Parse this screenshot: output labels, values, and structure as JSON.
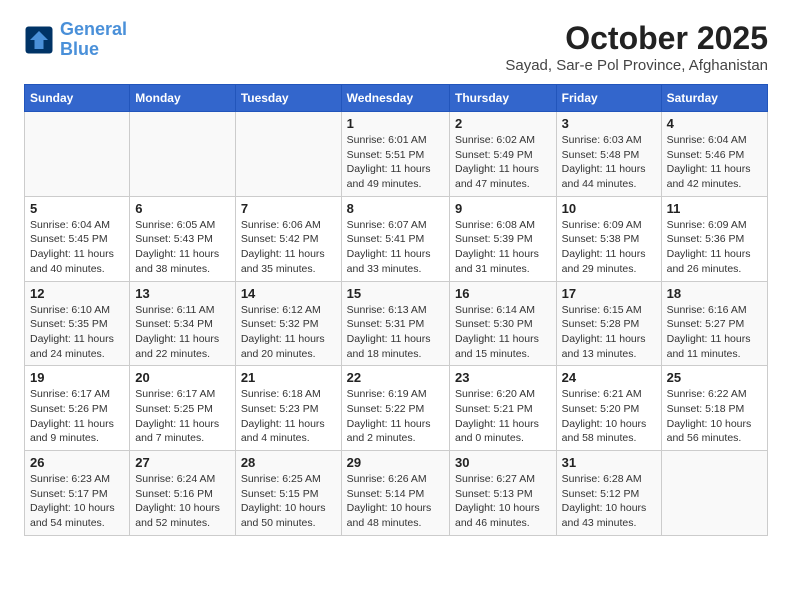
{
  "header": {
    "logo_line1": "General",
    "logo_line2": "Blue",
    "month": "October 2025",
    "location": "Sayad, Sar-e Pol Province, Afghanistan"
  },
  "days_of_week": [
    "Sunday",
    "Monday",
    "Tuesday",
    "Wednesday",
    "Thursday",
    "Friday",
    "Saturday"
  ],
  "weeks": [
    [
      {
        "day": "",
        "info": ""
      },
      {
        "day": "",
        "info": ""
      },
      {
        "day": "",
        "info": ""
      },
      {
        "day": "1",
        "info": "Sunrise: 6:01 AM\nSunset: 5:51 PM\nDaylight: 11 hours\nand 49 minutes."
      },
      {
        "day": "2",
        "info": "Sunrise: 6:02 AM\nSunset: 5:49 PM\nDaylight: 11 hours\nand 47 minutes."
      },
      {
        "day": "3",
        "info": "Sunrise: 6:03 AM\nSunset: 5:48 PM\nDaylight: 11 hours\nand 44 minutes."
      },
      {
        "day": "4",
        "info": "Sunrise: 6:04 AM\nSunset: 5:46 PM\nDaylight: 11 hours\nand 42 minutes."
      }
    ],
    [
      {
        "day": "5",
        "info": "Sunrise: 6:04 AM\nSunset: 5:45 PM\nDaylight: 11 hours\nand 40 minutes."
      },
      {
        "day": "6",
        "info": "Sunrise: 6:05 AM\nSunset: 5:43 PM\nDaylight: 11 hours\nand 38 minutes."
      },
      {
        "day": "7",
        "info": "Sunrise: 6:06 AM\nSunset: 5:42 PM\nDaylight: 11 hours\nand 35 minutes."
      },
      {
        "day": "8",
        "info": "Sunrise: 6:07 AM\nSunset: 5:41 PM\nDaylight: 11 hours\nand 33 minutes."
      },
      {
        "day": "9",
        "info": "Sunrise: 6:08 AM\nSunset: 5:39 PM\nDaylight: 11 hours\nand 31 minutes."
      },
      {
        "day": "10",
        "info": "Sunrise: 6:09 AM\nSunset: 5:38 PM\nDaylight: 11 hours\nand 29 minutes."
      },
      {
        "day": "11",
        "info": "Sunrise: 6:09 AM\nSunset: 5:36 PM\nDaylight: 11 hours\nand 26 minutes."
      }
    ],
    [
      {
        "day": "12",
        "info": "Sunrise: 6:10 AM\nSunset: 5:35 PM\nDaylight: 11 hours\nand 24 minutes."
      },
      {
        "day": "13",
        "info": "Sunrise: 6:11 AM\nSunset: 5:34 PM\nDaylight: 11 hours\nand 22 minutes."
      },
      {
        "day": "14",
        "info": "Sunrise: 6:12 AM\nSunset: 5:32 PM\nDaylight: 11 hours\nand 20 minutes."
      },
      {
        "day": "15",
        "info": "Sunrise: 6:13 AM\nSunset: 5:31 PM\nDaylight: 11 hours\nand 18 minutes."
      },
      {
        "day": "16",
        "info": "Sunrise: 6:14 AM\nSunset: 5:30 PM\nDaylight: 11 hours\nand 15 minutes."
      },
      {
        "day": "17",
        "info": "Sunrise: 6:15 AM\nSunset: 5:28 PM\nDaylight: 11 hours\nand 13 minutes."
      },
      {
        "day": "18",
        "info": "Sunrise: 6:16 AM\nSunset: 5:27 PM\nDaylight: 11 hours\nand 11 minutes."
      }
    ],
    [
      {
        "day": "19",
        "info": "Sunrise: 6:17 AM\nSunset: 5:26 PM\nDaylight: 11 hours\nand 9 minutes."
      },
      {
        "day": "20",
        "info": "Sunrise: 6:17 AM\nSunset: 5:25 PM\nDaylight: 11 hours\nand 7 minutes."
      },
      {
        "day": "21",
        "info": "Sunrise: 6:18 AM\nSunset: 5:23 PM\nDaylight: 11 hours\nand 4 minutes."
      },
      {
        "day": "22",
        "info": "Sunrise: 6:19 AM\nSunset: 5:22 PM\nDaylight: 11 hours\nand 2 minutes."
      },
      {
        "day": "23",
        "info": "Sunrise: 6:20 AM\nSunset: 5:21 PM\nDaylight: 11 hours\nand 0 minutes."
      },
      {
        "day": "24",
        "info": "Sunrise: 6:21 AM\nSunset: 5:20 PM\nDaylight: 10 hours\nand 58 minutes."
      },
      {
        "day": "25",
        "info": "Sunrise: 6:22 AM\nSunset: 5:18 PM\nDaylight: 10 hours\nand 56 minutes."
      }
    ],
    [
      {
        "day": "26",
        "info": "Sunrise: 6:23 AM\nSunset: 5:17 PM\nDaylight: 10 hours\nand 54 minutes."
      },
      {
        "day": "27",
        "info": "Sunrise: 6:24 AM\nSunset: 5:16 PM\nDaylight: 10 hours\nand 52 minutes."
      },
      {
        "day": "28",
        "info": "Sunrise: 6:25 AM\nSunset: 5:15 PM\nDaylight: 10 hours\nand 50 minutes."
      },
      {
        "day": "29",
        "info": "Sunrise: 6:26 AM\nSunset: 5:14 PM\nDaylight: 10 hours\nand 48 minutes."
      },
      {
        "day": "30",
        "info": "Sunrise: 6:27 AM\nSunset: 5:13 PM\nDaylight: 10 hours\nand 46 minutes."
      },
      {
        "day": "31",
        "info": "Sunrise: 6:28 AM\nSunset: 5:12 PM\nDaylight: 10 hours\nand 43 minutes."
      },
      {
        "day": "",
        "info": ""
      }
    ]
  ]
}
